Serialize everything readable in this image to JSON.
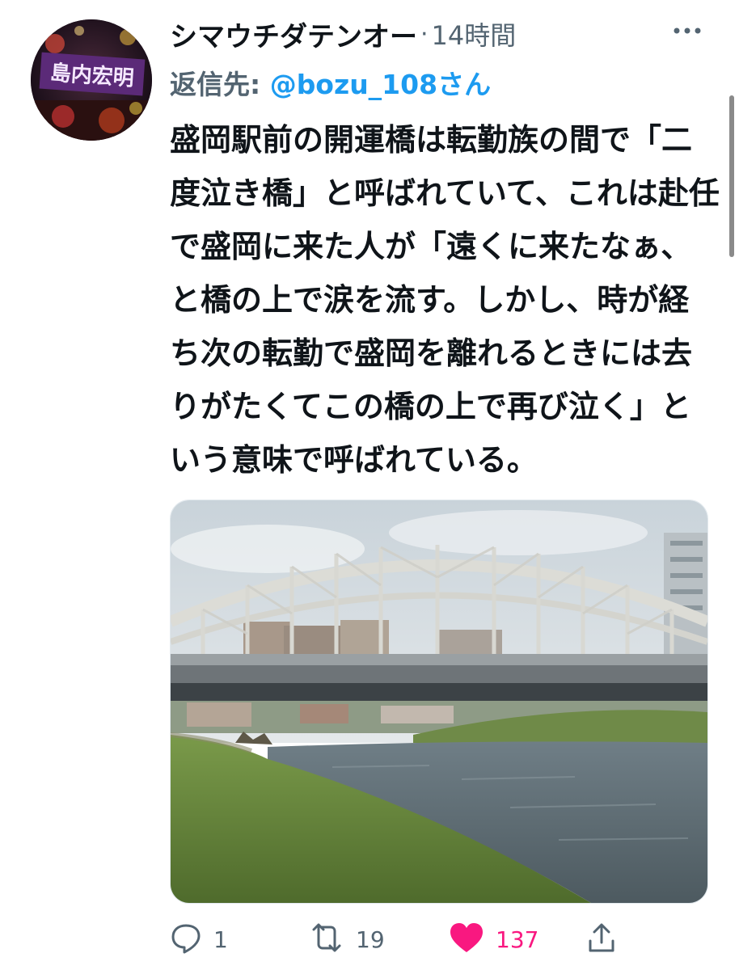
{
  "tweet": {
    "display_name": "シマウチダテンオー",
    "separator": "·",
    "timestamp": "14時間",
    "reply_label": "返信先: ",
    "reply_handle": "@bozu_108さん",
    "text": "盛岡駅前の開運橋は転勤族の間で「二度泣き橋」と呼ばれていて、これは赴任で盛岡に来た人が「遠くに来たなぁ、と橋の上で涙を流す。しかし、時が経ち次の転勤で盛岡を離れるときには去りがたくてこの橋の上で再び泣く」という意味で呼ばれている。",
    "avatar_banner_text": "島内宏明"
  },
  "actions": {
    "reply_icon": "reply-icon",
    "reply_count": "1",
    "retweet_icon": "retweet-icon",
    "retweet_count": "19",
    "like_icon": "heart-icon",
    "like_count": "137",
    "share_icon": "share-icon"
  },
  "colors": {
    "link": "#1d9bf0",
    "secondary": "#536471",
    "like": "#f91880",
    "text": "#0f1419"
  }
}
